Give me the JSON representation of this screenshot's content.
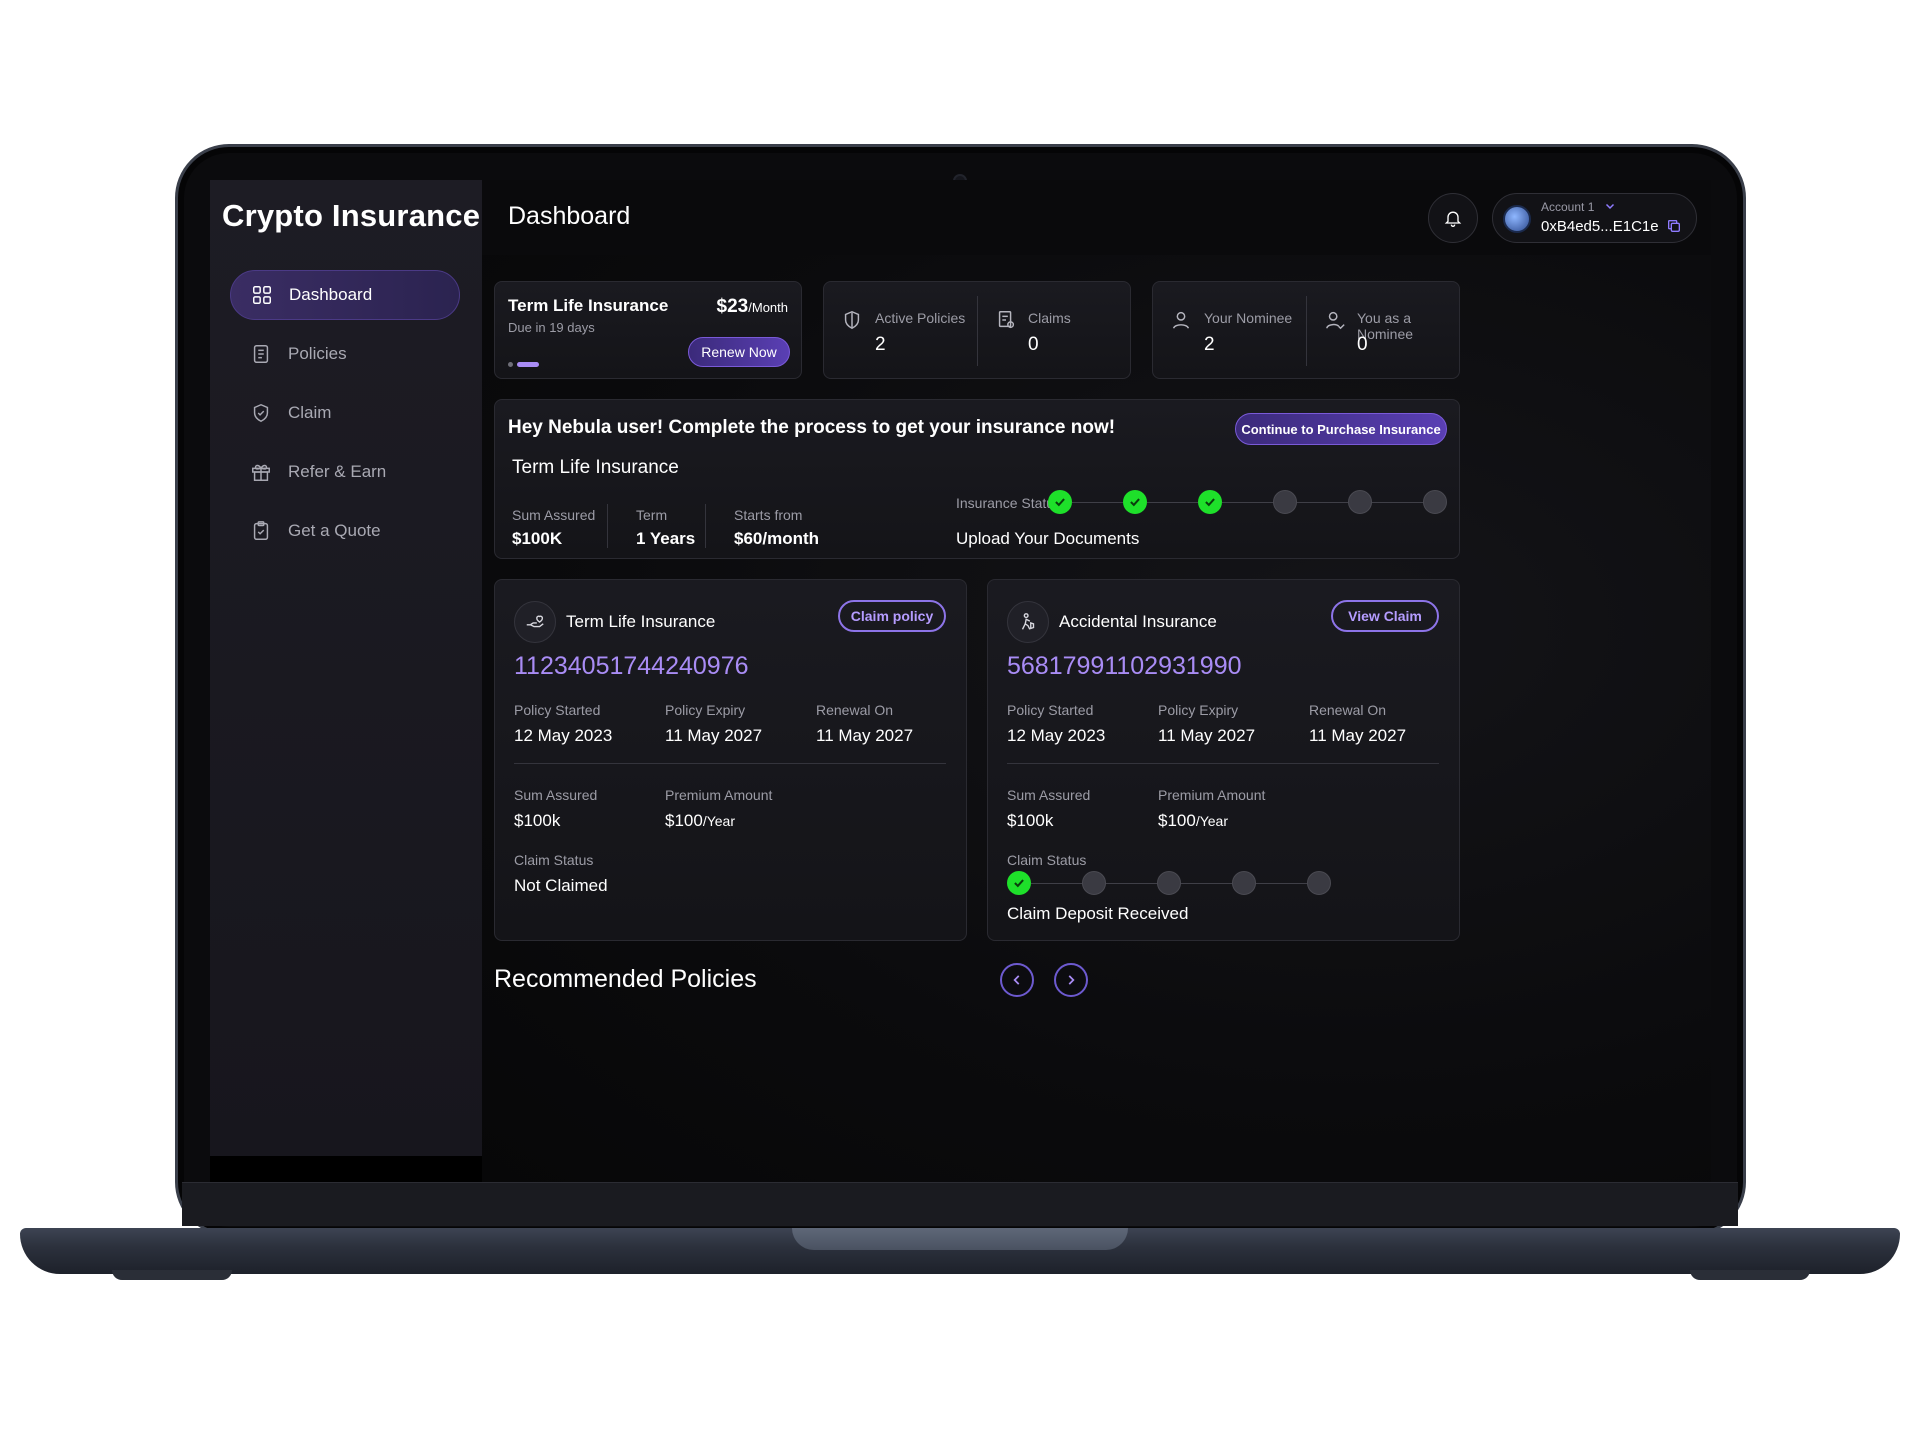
{
  "brand": "Crypto Insurance",
  "page_title": "Dashboard",
  "nav": [
    {
      "label": "Dashboard",
      "icon": "grid-icon",
      "active": true
    },
    {
      "label": "Policies",
      "icon": "document-icon"
    },
    {
      "label": "Claim",
      "icon": "shield-check-icon"
    },
    {
      "label": "Refer & Earn",
      "icon": "gift-icon"
    },
    {
      "label": "Get a Quote",
      "icon": "clipboard-check-icon"
    }
  ],
  "account": {
    "label": "Account 1",
    "address": "0xB4ed5...E1C1e"
  },
  "due_card": {
    "title": "Term Life Insurance",
    "price": "$23",
    "price_unit": "/Month",
    "due": "Due in 19 days",
    "button": "Renew Now"
  },
  "policy_stats": {
    "active_label": "Active Policies",
    "active_value": "2",
    "claims_label": "Claims",
    "claims_value": "0"
  },
  "nominee_stats": {
    "your_label": "Your Nominee",
    "your_value": "2",
    "as_label": "You as a Nominee",
    "as_value": "0"
  },
  "banner": {
    "heading": "Hey Nebula user! Complete the process to get your insurance now!",
    "button": "Continue to Purchase Insurance",
    "product": "Term Life Insurance",
    "sum_label": "Sum Assured",
    "sum_value": "$100K",
    "term_label": "Term",
    "term_value": "1 Years",
    "starts_label": "Starts from",
    "starts_value": "$60/month",
    "status_label": "Insurance Status",
    "status_step_text": "Upload Your Documents",
    "steps_total": 6,
    "steps_done": 3
  },
  "policy_cards": [
    {
      "name": "Term Life Insurance",
      "button": "Claim policy",
      "number": "11234051744240976",
      "started_label": "Policy Started",
      "started": "12 May 2023",
      "expiry_label": "Policy Expiry",
      "expiry": "11 May 2027",
      "renewal_label": "Renewal On",
      "renewal": "11 May 2027",
      "sum_label": "Sum Assured",
      "sum": "$100k",
      "premium_label": "Premium Amount",
      "premium": "$100",
      "premium_unit": "/Year",
      "claim_label": "Claim Status",
      "claim_status": "Not Claimed"
    },
    {
      "name": "Accidental Insurance",
      "button": "View Claim",
      "number": "56817991102931990",
      "started_label": "Policy Started",
      "started": "12 May 2023",
      "expiry_label": "Policy Expiry",
      "expiry": "11 May 2027",
      "renewal_label": "Renewal On",
      "renewal": "11 May 2027",
      "sum_label": "Sum Assured",
      "sum": "$100k",
      "premium_label": "Premium Amount",
      "premium": "$100",
      "premium_unit": "/Year",
      "claim_label": "Claim Status",
      "claim_status": "Claim Deposit Received",
      "claim_steps_total": 5,
      "claim_steps_done": 1
    }
  ],
  "recommended_title": "Recommended Policies",
  "colors": {
    "accent": "#7a5ad8",
    "success": "#1ee02a",
    "purple_text": "#a98cf5"
  }
}
